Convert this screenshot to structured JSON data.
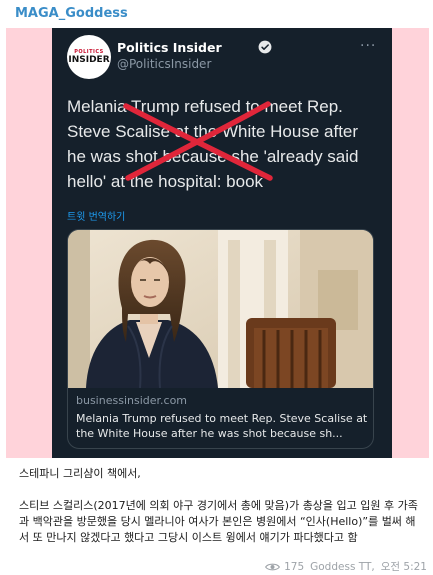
{
  "message": {
    "author": "MAGA_Goddess",
    "tweet": {
      "account_name": "Politics Insider",
      "account_handle": "@PoliticsInsider",
      "avatar_line1": "POLITICS",
      "avatar_line2": "INSIDER",
      "more_icon": "more-horizontal-icon",
      "headline_lines": [
        "Melania Trump refused to meet Rep.",
        "Steve Scalise at the White House after",
        "he was shot because she 'already said",
        "hello' at the hospital: book"
      ],
      "translate_label": "트윗 번역하기",
      "card": {
        "domain": "businessinsider.com",
        "title": "Melania Trump refused to meet Rep. Steve Scalise at the White House after he was shot because sh..."
      }
    },
    "caption": {
      "line1": "스테파니 그리샴이 책에서,",
      "line2": "스티브 스컬리스(2017년에 의회 야구 경기에서 총에 맞음)가 총상을 입고 입원 후 가족과 백악관을 방문했을 당시 멜라니아 여사가 본인은 병원에서 “인사(Hello)”를 벌써 해서 또 만나지 않겠다고 했다고  그당시 이스트 윙에서 얘기가 파다했다고 함"
    },
    "meta": {
      "views": "175",
      "signature": "Goddess TT,",
      "time": "오전 5:21"
    }
  },
  "colors": {
    "author": "#3a8dc8",
    "media_background": "#ffd3da",
    "tweet_background": "#15202b",
    "annotation_x": "#e0263a",
    "link_blue": "#1d9bf0"
  }
}
